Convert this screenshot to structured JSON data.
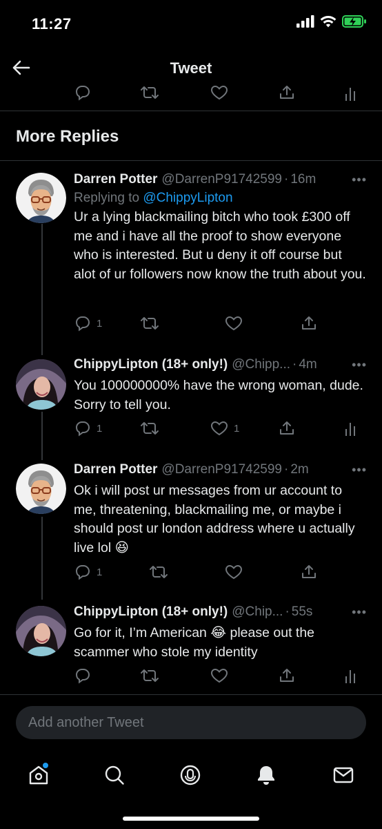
{
  "status": {
    "time": "11:27"
  },
  "header": {
    "title": "Tweet"
  },
  "section": {
    "title": "More Replies"
  },
  "tweets": [
    {
      "name": "Darren Potter",
      "handle": "@DarrenP91742599",
      "time": "16m",
      "replying_prefix": "Replying to ",
      "replying_to": "@ChippyLipton",
      "text": "Ur a lying blackmailing bitch who took £300 off me and i have all the proof to show everyone who is interested. But u deny it off course but alot of ur followers now know the truth about you.",
      "reply_count": "1",
      "like_count": ""
    },
    {
      "name": "ChippyLipton (18+ only!)",
      "handle": "@Chipp...",
      "time": "4m",
      "text": "You 100000000% have the wrong woman, dude. Sorry to tell you.",
      "reply_count": "1",
      "like_count": "1"
    },
    {
      "name": "Darren Potter",
      "handle": "@DarrenP91742599",
      "time": "2m",
      "text": "Ok i will post ur messages from ur account to me, threatening, blackmailing me, or maybe i should post ur london address where u actually live lol 😆",
      "reply_count": "1",
      "like_count": ""
    },
    {
      "name": "ChippyLipton (18+ only!)",
      "handle": "@Chip...",
      "time": "55s",
      "text": "Go for it, I’m American 😂 please out the scammer who stole my identity",
      "reply_count": "",
      "like_count": ""
    }
  ],
  "compose": {
    "placeholder": "Add another Tweet"
  },
  "icons": {
    "back": "arrow-left-icon",
    "reply": "reply-icon",
    "retweet": "retweet-icon",
    "like": "heart-icon",
    "share": "share-icon",
    "analytics": "analytics-icon",
    "tabs": [
      "home-icon",
      "search-icon",
      "spaces-icon",
      "notifications-icon",
      "messages-icon"
    ]
  },
  "colors": {
    "accent": "#1d9bf0",
    "muted": "#71767b",
    "text": "#e7e9ea",
    "background": "#000000"
  }
}
